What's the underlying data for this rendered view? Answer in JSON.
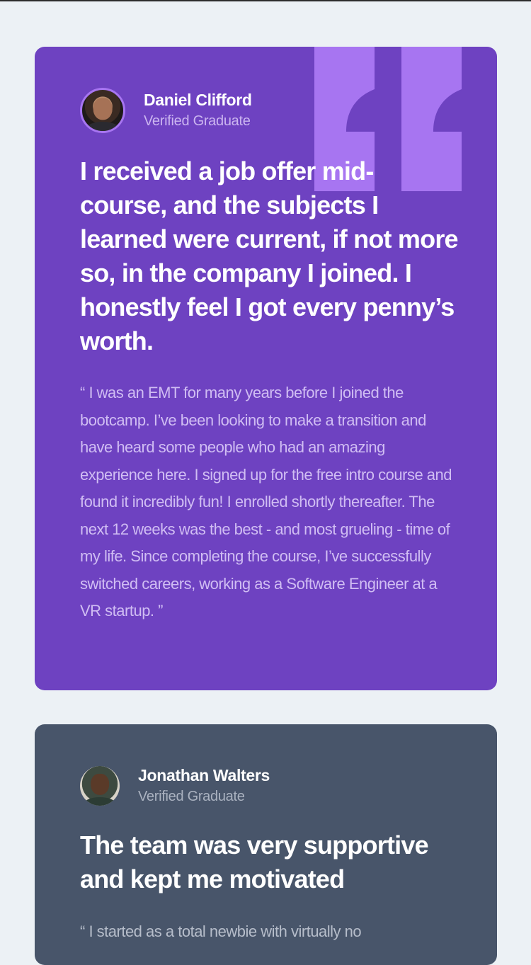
{
  "colors": {
    "page_background": "#ecf1f5",
    "card_1_background": "#6e42c1",
    "card_2_background": "#48556a",
    "quote_icon": "#a775f1"
  },
  "testimonials": [
    {
      "name": "Daniel Clifford",
      "role": "Verified Graduate",
      "avatar_icon": "avatar-photo",
      "headline": "I received a job offer mid-course, and the subjects I learned were current, if not more so, in the company I joined. I honestly feel I got every penny’s worth.",
      "body": "“ I was an EMT for many years before I joined the bootcamp. I’ve been looking to make a transition and have heard some people who had an amazing experience here. I signed up for the free intro course and found it incredibly fun! I enrolled shortly thereafter. The next 12 weeks was the best - and most grueling - time of my life. Since completing the course, I’ve successfully switched careers, working as a Software Engineer at a VR startup. ”"
    },
    {
      "name": "Jonathan Walters",
      "role": "Verified Graduate",
      "avatar_icon": "avatar-photo",
      "headline": "The team was very supportive and kept me motivated",
      "body": "“ I started as a total newbie with virtually no"
    }
  ]
}
